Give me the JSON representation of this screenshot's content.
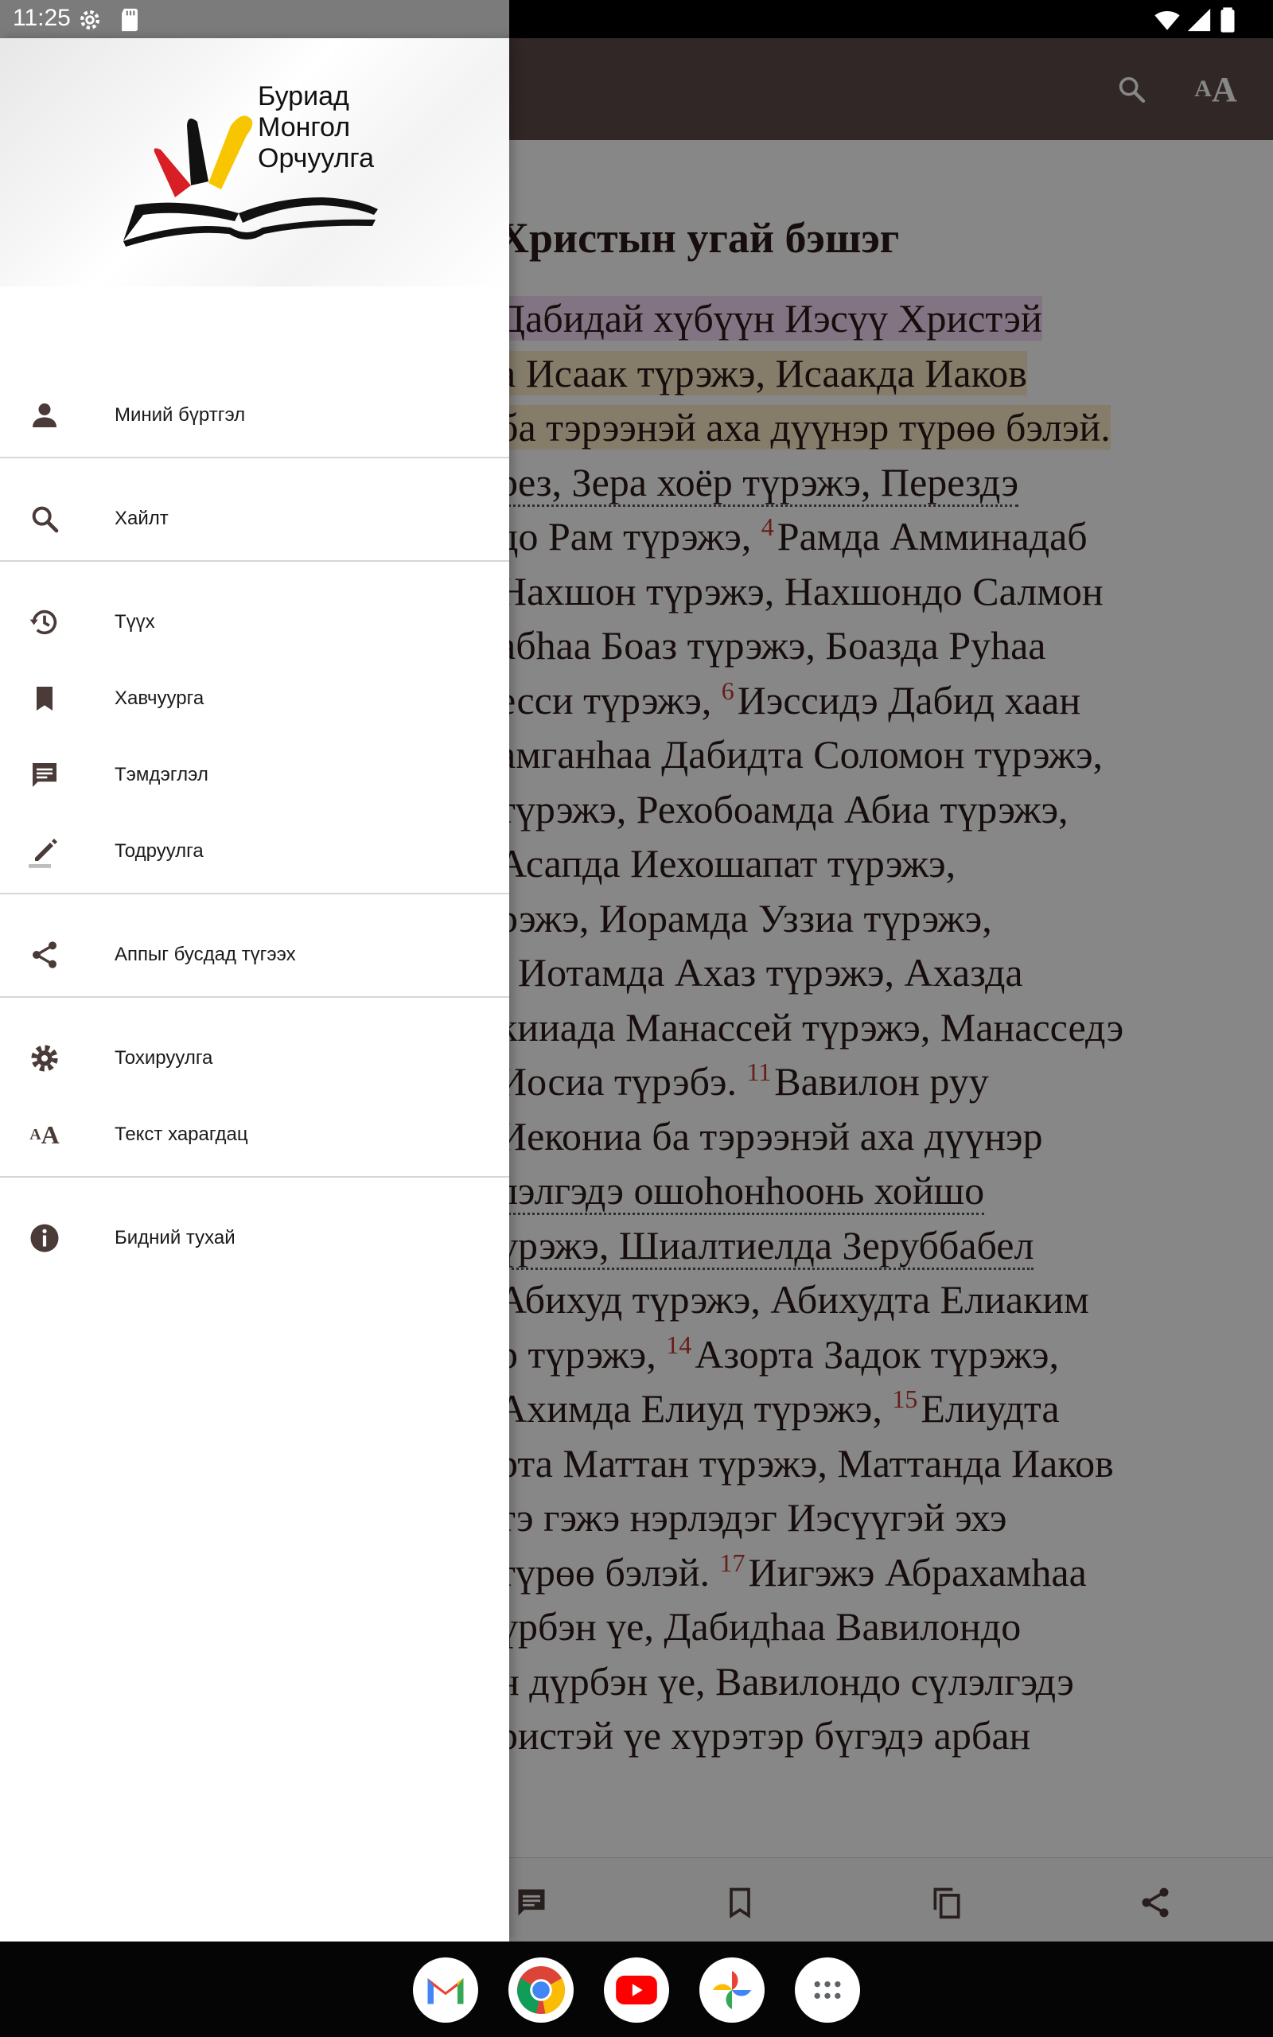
{
  "status_bar": {
    "time": "11:25",
    "icons": [
      "settings-icon",
      "sd-card-icon",
      "wifi-icon",
      "signal-icon",
      "battery-icon"
    ]
  },
  "app_bar": {
    "icons": [
      "search-icon",
      "text-size-icon"
    ],
    "text_size_small": "A",
    "text_size_big": "A"
  },
  "reader": {
    "title": "Христын угай бэшэг",
    "lines": [
      {
        "text": "Дабидай хүбүүн Иэсүү Христэй",
        "highlight": "pink"
      },
      {
        "text": "а Исаак түрэжэ, Исаакда Иаков",
        "highlight": "yellow"
      },
      {
        "text": "ба тэрээнэй аха дүүнэр түрөө бэлэй.",
        "highlight": "yellow"
      },
      {
        "text": "рез, Зера хоёр түрэжэ, Перездэ",
        "underline": true
      },
      {
        "pre": "до Рам түрэжэ, ",
        "verse": "4",
        "post": "Рамда Амминадаб"
      },
      {
        "text": "Нахшон түрэжэ, Нахшондо Салмон"
      },
      {
        "text": "абһаа Боаз түрэжэ, Боазда Руһаа"
      },
      {
        "pre": "есси түрэжэ, ",
        "verse": "6",
        "post": "Иэссидэ Дабид хаан"
      },
      {
        "text": "амганһаа Дабидта Соломон түрэжэ,"
      },
      {
        "text": "түрэжэ, Рехобоамда Абиа түрэжэ,"
      },
      {
        "text": "Асапда Иехошапат түрэжэ,"
      },
      {
        "text": "рэжэ, Иорамда Уззиа түрэжэ,"
      },
      {
        "text": ", Иотамда Ахаз түрэжэ, Ахазда"
      },
      {
        "text": "кииада Манассей түрэжэ, Манасседэ"
      },
      {
        "pre": "Иосиа түрэбэ. ",
        "verse": "11",
        "post": "Вавилон руу"
      },
      {
        "text": "Иекониа ба тэрээнэй аха дүүнэр"
      },
      {
        "text": "лэлгэдэ ошоһонһоонь хойшо",
        "underline": true
      },
      {
        "text": "үрэжэ, Шиалтиелда Зеруббабел",
        "underline": true
      },
      {
        "text": "Абихуд түрэжэ, Абихудта Елиаким"
      },
      {
        "pre": "р түрэжэ, ",
        "verse": "14",
        "post": "Азорта Задок түрэжэ,"
      },
      {
        "pre": "Ахимда Елиуд түрэжэ, ",
        "verse": "15",
        "post": "Елиудта"
      },
      {
        "text": "рта Маттан түрэжэ, Маттанда Иаков"
      },
      {
        "text": "тэ гэжэ нэрлэдэг Иэсүүгэй эхэ"
      },
      {
        "pre": "түрөө бэлэй. ",
        "verse": "17",
        "post": "Иигэжэ Абрахамһаа"
      },
      {
        "text": "үрбэн үе, Дабидһаа Вавилондо"
      },
      {
        "text": "н дүрбэн үе, Вавилондо сүлэлгэдэ"
      },
      {
        "text": "ристэй үе хүрэтэр бүгэдэ арбан"
      }
    ]
  },
  "bottom_bar": {
    "icons": [
      "note-icon",
      "bookmark-icon",
      "copy-icon",
      "share-icon"
    ]
  },
  "drawer": {
    "logo": {
      "line1": "Буриад",
      "line2": "Монгол",
      "line3": "Орчуулга"
    },
    "items": [
      {
        "label": "Миний бүртгэл",
        "icon": "person-icon"
      },
      {
        "label": "Хайлт",
        "icon": "search-icon"
      },
      {
        "label": "Түүх",
        "icon": "history-icon"
      },
      {
        "label": "Хавчуурга",
        "icon": "bookmark-icon"
      },
      {
        "label": "Тэмдэглэл",
        "icon": "note-icon"
      },
      {
        "label": "Тодруулга",
        "icon": "highlight-pen-icon"
      },
      {
        "label": "Аппыг бусдад түгээх",
        "icon": "share-icon"
      },
      {
        "label": "Тохируулга",
        "icon": "settings-icon"
      },
      {
        "label": "Текст харагдац",
        "icon": "text-size-icon",
        "icon_small": "A",
        "icon_big": "A"
      },
      {
        "label": "Бидний тухай",
        "icon": "info-icon"
      }
    ]
  },
  "dock": {
    "apps": [
      "gmail-icon",
      "chrome-icon",
      "youtube-icon",
      "photos-icon",
      "app-drawer-icon"
    ]
  },
  "colors": {
    "app_bar": "#5b4b48",
    "icon_dark": "#4a3a38",
    "verse_number": "#c0392b",
    "highlight_pink": "#f6dcf6",
    "highlight_yellow": "#fbedc9"
  }
}
